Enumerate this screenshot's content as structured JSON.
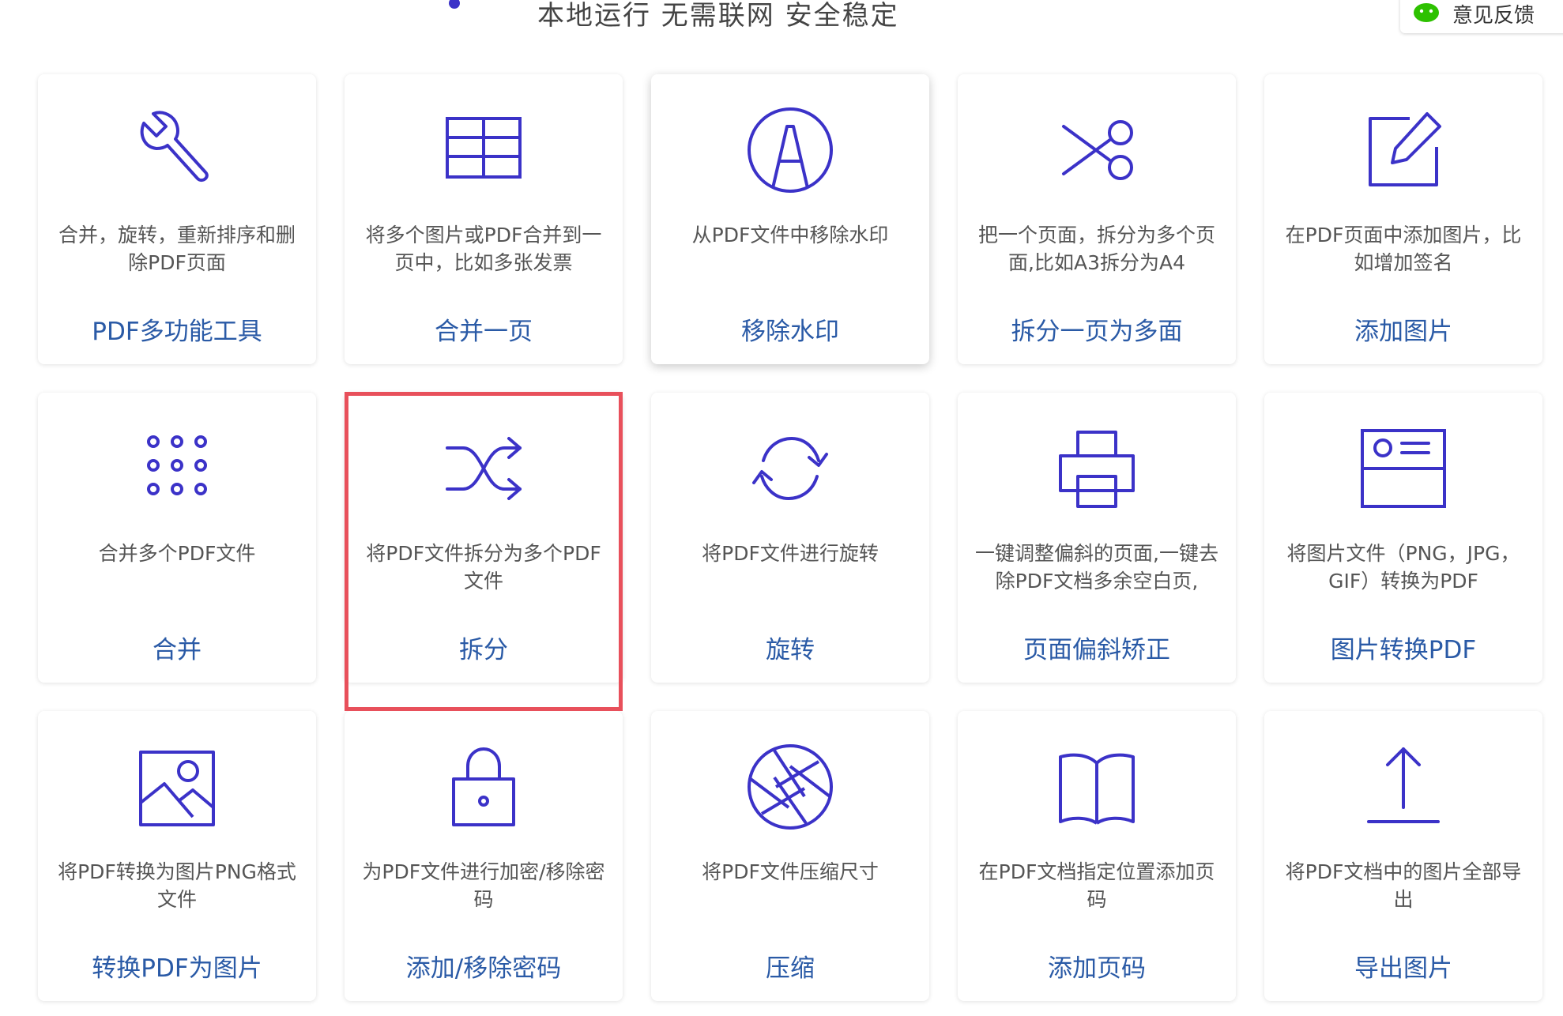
{
  "header": {
    "tagline": "本地运行 无需联网 安全稳定",
    "feedback_label": "意见反馈"
  },
  "colors": {
    "icon_stroke": "#3b32c8",
    "title_text": "#2a5aa6",
    "highlight_border": "#e8505b",
    "wechat_green": "#2dc100"
  },
  "tools": [
    {
      "icon": "wrench-icon",
      "desc": "合并，旋转，重新排序和删除PDF页面",
      "title": "PDF多功能工具"
    },
    {
      "icon": "grid-table-icon",
      "desc": "将多个图片或PDF合并到一页中，比如多张发票",
      "title": "合并一页"
    },
    {
      "icon": "watermark-a-icon",
      "desc": "从PDF文件中移除水印",
      "title": "移除水印"
    },
    {
      "icon": "scissors-icon",
      "desc": "把一个页面，拆分为多个页面,比如A3拆分为A4",
      "title": "拆分一页为多面"
    },
    {
      "icon": "edit-square-icon",
      "desc": "在PDF页面中添加图片，比如增加签名",
      "title": "添加图片"
    },
    {
      "icon": "dots-grid-icon",
      "desc": "合并多个PDF文件",
      "title": "合并"
    },
    {
      "icon": "shuffle-icon",
      "desc": "将PDF文件拆分为多个PDF文件",
      "title": "拆分"
    },
    {
      "icon": "rotate-icon",
      "desc": "将PDF文件进行旋转",
      "title": "旋转"
    },
    {
      "icon": "printer-icon",
      "desc": "一键调整偏斜的页面,一键去除PDF文档多余空白页,",
      "title": "页面偏斜矫正"
    },
    {
      "icon": "id-card-icon",
      "desc": "将图片文件（PNG，JPG，GIF）转换为PDF",
      "title": "图片转换PDF"
    },
    {
      "icon": "image-icon",
      "desc": "将PDF转换为图片PNG格式文件",
      "title": "转换PDF为图片"
    },
    {
      "icon": "lock-icon",
      "desc": "为PDF文件进行加密/移除密码",
      "title": "添加/移除密码"
    },
    {
      "icon": "aperture-icon",
      "desc": "将PDF文件压缩尺寸",
      "title": "压缩"
    },
    {
      "icon": "book-open-icon",
      "desc": "在PDF文档指定位置添加页码",
      "title": "添加页码"
    },
    {
      "icon": "upload-icon",
      "desc": "将PDF文档中的图片全部导出",
      "title": "导出图片"
    }
  ]
}
